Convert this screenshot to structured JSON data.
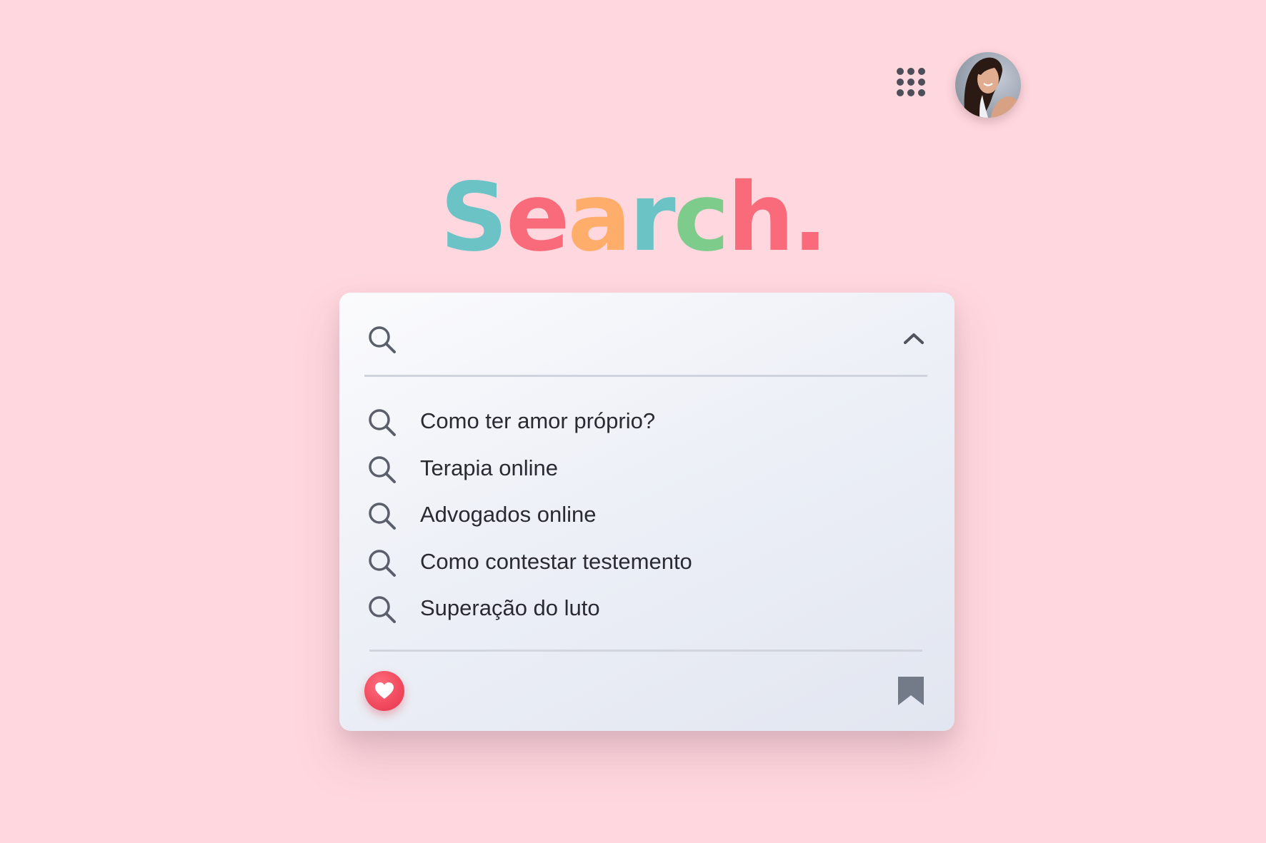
{
  "header": {
    "apps_icon": "apps-grid-icon",
    "avatar_icon": "user-avatar"
  },
  "logo": {
    "letters": [
      {
        "char": "S",
        "color": "#6bc3c6"
      },
      {
        "char": "e",
        "color": "#f96b7a"
      },
      {
        "char": "a",
        "color": "#ffad6b"
      },
      {
        "char": "r",
        "color": "#6bc3c6"
      },
      {
        "char": "c",
        "color": "#7dcc8b"
      },
      {
        "char": "h",
        "color": "#f96b7a"
      },
      {
        "char": ".",
        "color": "#f96b7a"
      }
    ]
  },
  "search": {
    "value": "",
    "placeholder": "",
    "icon": "search-icon",
    "collapse_icon": "chevron-up-icon"
  },
  "suggestions": [
    {
      "label": "Como ter amor próprio?",
      "icon": "search-icon"
    },
    {
      "label": "Terapia online",
      "icon": "search-icon"
    },
    {
      "label": "Advogados online",
      "icon": "search-icon"
    },
    {
      "label": "Como contestar testemento",
      "icon": "search-icon"
    },
    {
      "label": "Superação do luto",
      "icon": "search-icon"
    }
  ],
  "footer": {
    "favorite_icon": "heart-icon",
    "bookmark_icon": "bookmark-icon"
  },
  "colors": {
    "background": "#ffd7de",
    "icon_gray": "#5a5f6b",
    "heart_red": "#f0485c",
    "bookmark_gray": "#737b89"
  }
}
